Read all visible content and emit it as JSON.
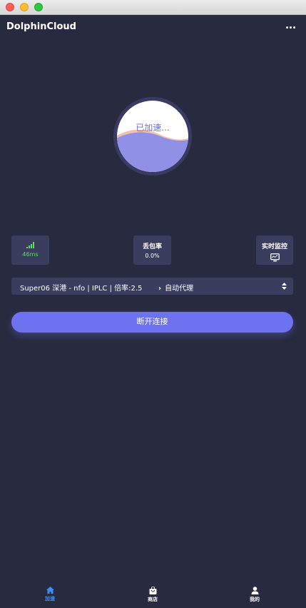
{
  "window": {
    "controls": [
      "close",
      "minimize",
      "maximize"
    ]
  },
  "header": {
    "title": "DolphinCloud",
    "menu_icon": "more-horizontal-icon"
  },
  "status_orb": {
    "label": "已加速...",
    "fill_level": 0.45,
    "colors": {
      "fill": "#8f90e6",
      "ring": "#3a3b63",
      "inner": "#ffffff",
      "text": "#6e72d8"
    }
  },
  "stats": {
    "latency": {
      "value": "46ms",
      "icon": "signal-bars-icon",
      "color": "#5ae15a"
    },
    "packet_loss": {
      "title": "丢包率",
      "value": "0.0%"
    },
    "monitor": {
      "title": "实时监控",
      "icon": "monitor-icon"
    }
  },
  "server": {
    "name": "Super06 深港 - nfo | IPLC | 倍率:2.5",
    "mode": "自动代理",
    "mode_icon": "chevron-right-icon",
    "select_icon": "up-down-icon"
  },
  "connect_button": {
    "label": "断开连接",
    "color": "#6c72f0"
  },
  "bottom_nav": {
    "active": "home",
    "items": [
      {
        "id": "home",
        "label": "加速",
        "icon": "home-icon"
      },
      {
        "id": "store",
        "label": "商店",
        "icon": "shopping-bag-icon"
      },
      {
        "id": "me",
        "label": "我的",
        "icon": "user-icon"
      }
    ],
    "active_color": "#3f8ef7"
  },
  "theme": {
    "background": "#282a40",
    "card": "#3a3d5e"
  }
}
